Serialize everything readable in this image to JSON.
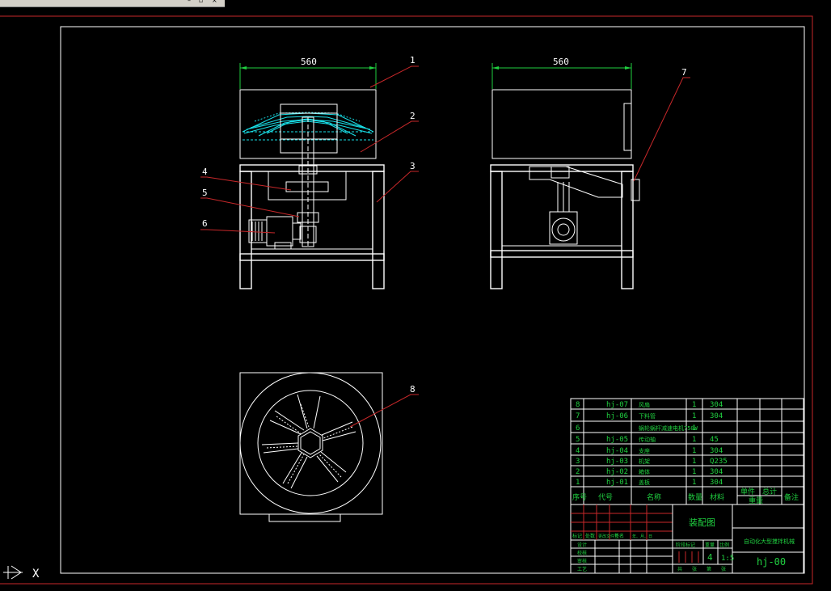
{
  "window": {
    "icons": [
      "minimize-icon",
      "restore-icon",
      "close-icon"
    ]
  },
  "drawing": {
    "dimensions": {
      "front_width": "560",
      "side_width": "560"
    },
    "balloons": [
      "1",
      "2",
      "3",
      "4",
      "5",
      "6",
      "7",
      "8"
    ]
  },
  "bom": {
    "rows": [
      {
        "no": "8",
        "code": "hj-07",
        "name": "风扇",
        "qty": "1",
        "material": "304"
      },
      {
        "no": "7",
        "code": "hj-06",
        "name": "下料管",
        "qty": "1",
        "material": "304"
      },
      {
        "no": "6",
        "code": "",
        "name": "蜗轮蜗杆减速电机750W",
        "qty": "1",
        "material": ""
      },
      {
        "no": "5",
        "code": "hj-05",
        "name": "传动轴",
        "qty": "1",
        "material": "45"
      },
      {
        "no": "4",
        "code": "hj-04",
        "name": "支座",
        "qty": "1",
        "material": "304"
      },
      {
        "no": "3",
        "code": "hj-03",
        "name": "机架",
        "qty": "1",
        "material": "Q235"
      },
      {
        "no": "2",
        "code": "hj-02",
        "name": "箱体",
        "qty": "1",
        "material": "304"
      },
      {
        "no": "1",
        "code": "hj-01",
        "name": "盖板",
        "qty": "1",
        "material": "304"
      }
    ],
    "header": {
      "no": "序号",
      "code": "代号",
      "name": "名称",
      "qty": "数量",
      "material": "材料",
      "single": "单件",
      "total": "总计",
      "weight": "重量",
      "remark": "备注"
    }
  },
  "title_block": {
    "drawing_name": "装配图",
    "company": "自动化大型搅拌机械",
    "drawing_no": "hj-00",
    "sheets": "4",
    "scale": "1:5",
    "rows_left": [
      "设计",
      "校核",
      "审核",
      "工艺"
    ],
    "hdr": [
      "标记",
      "处数",
      "更改文件号",
      "签名",
      "年、月、日"
    ],
    "stage": [
      "阶段标记",
      "重量",
      "比例"
    ],
    "sheet_labels": [
      "共",
      "张",
      "第",
      "张"
    ]
  },
  "cmd": {
    "coords_icon": "ucs-icon",
    "axis_label": "X"
  }
}
